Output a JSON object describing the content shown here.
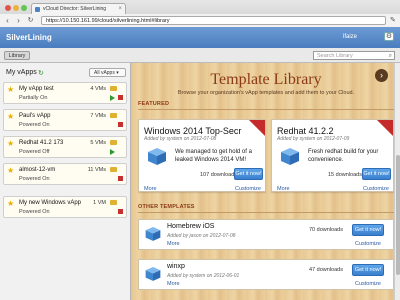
{
  "browser": {
    "tab_title": "vCloud Director: SilverLining",
    "tab_close": "×",
    "back": "‹",
    "forward": "›",
    "reload": "↻",
    "url": "https://10.150.161.99/cloud/silverlining.html#library",
    "window_buttons": {
      "close": "#e4544d",
      "minimize": "#e8b53a",
      "maximize": "#62c454"
    }
  },
  "header": {
    "brand": "SilverLining",
    "user": "lfaize",
    "settings_icon": "gear-icon"
  },
  "subbar": {
    "library_tab": "Library",
    "search_placeholder": "Search Library"
  },
  "sidebar": {
    "title": "My vApps",
    "filter": "All vApps",
    "items": [
      {
        "name": "My vApp test",
        "status": "Partially On",
        "vms": "4 VMs"
      },
      {
        "name": "Paul's vApp",
        "status": "Powered On",
        "vms": "7 VMs"
      },
      {
        "name": "Redhat 41.2 173",
        "status": "Powered Off",
        "vms": "5 VMs"
      },
      {
        "name": "almost-12-vm",
        "status": "Powered On",
        "vms": "11 VMs"
      },
      {
        "name": "My new Windows vApp",
        "status": "Powered On",
        "vms": "1 VM"
      }
    ]
  },
  "main": {
    "title": "Template Library",
    "subtitle": "Browse your organization's vApp templates and add them to your Cloud.",
    "featured_label": "FEATURED",
    "other_label": "OTHER TEMPLATES",
    "featured": [
      {
        "title": "Windows 2014 Top-Secr",
        "added": "Added by system on 2012-07-08",
        "desc": "We managed to get hold of a leaked Windows 2014 VM!",
        "downloads": "107 downloads",
        "button": "Get it now!",
        "more": "More",
        "customize": "Customize"
      },
      {
        "title": "Redhat 41.2.2",
        "added": "Added by system on 2012-07-09",
        "desc": "Fresh redhat build for your convenience.",
        "downloads": "15 downloads",
        "button": "Get it now!",
        "more": "More",
        "customize": "Customize"
      }
    ],
    "others": [
      {
        "title": "Homebrew iOS",
        "added": "Added by jason on 2012-07-08",
        "downloads": "70 downloads",
        "button": "Get it now!",
        "more": "More",
        "customize": "Customize"
      },
      {
        "title": "winxp",
        "added": "Added by system on 2012-06-01",
        "downloads": "47 downloads",
        "button": "Get it now!",
        "more": "More",
        "customize": "Customize"
      }
    ]
  }
}
